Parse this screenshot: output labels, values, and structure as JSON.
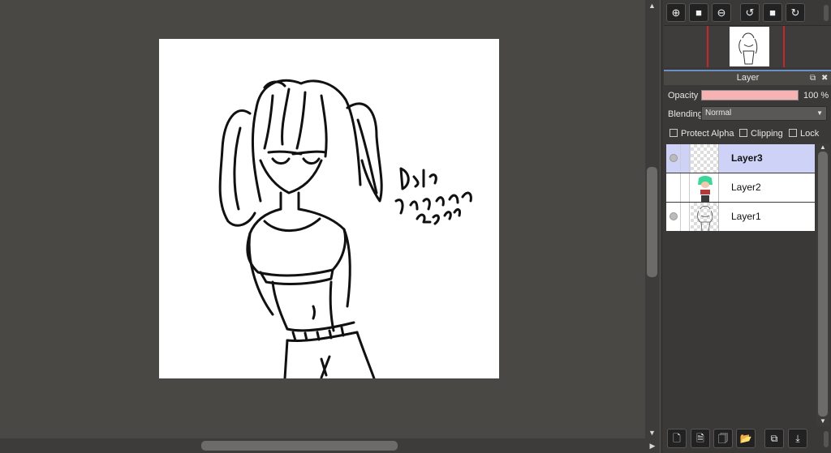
{
  "navigator": {
    "buttons": [
      {
        "name": "zoom-in-icon",
        "glyph": "⊕"
      },
      {
        "name": "fit-icon",
        "glyph": "■"
      },
      {
        "name": "zoom-out-icon",
        "glyph": "⊖"
      },
      {
        "name": "rotate-left-icon",
        "glyph": "↺"
      },
      {
        "name": "reset-rotation-icon",
        "glyph": "■"
      },
      {
        "name": "rotate-right-icon",
        "glyph": "↻"
      }
    ]
  },
  "layer_panel": {
    "title": "Layer",
    "opacity_label": "Opacity",
    "opacity_value": "100 %",
    "opacity_fraction": 1.0,
    "blending_label": "Blending",
    "blending_value": "Normal",
    "checkboxes": {
      "protect_alpha": "Protect Alpha",
      "clipping": "Clipping",
      "lock": "Lock"
    },
    "layers": [
      {
        "name": "Layer3",
        "selected": true,
        "visible": true
      },
      {
        "name": "Layer2",
        "selected": false,
        "visible": false
      },
      {
        "name": "Layer1",
        "selected": false,
        "visible": true
      }
    ],
    "bottom_buttons": [
      {
        "name": "new-layer-icon",
        "glyph": "🗋"
      },
      {
        "name": "new-halftone-layer-icon",
        "glyph": "🗎"
      },
      {
        "name": "new-1bit-layer-icon",
        "glyph": "🗍"
      },
      {
        "name": "new-folder-icon",
        "glyph": "📂"
      },
      {
        "name": "duplicate-layer-icon",
        "glyph": "⧉"
      },
      {
        "name": "merge-down-icon",
        "glyph": "⤓"
      }
    ]
  },
  "canvas": {
    "signature_lines": [
      "Dd047",
      "Ironmyram",
      "2302"
    ]
  },
  "colors": {
    "accent": "#6d8fc7",
    "selected_layer": "#cfd2f7",
    "opacity_bar": "#f5b3b3",
    "navigator_frame": "#c8262a"
  }
}
